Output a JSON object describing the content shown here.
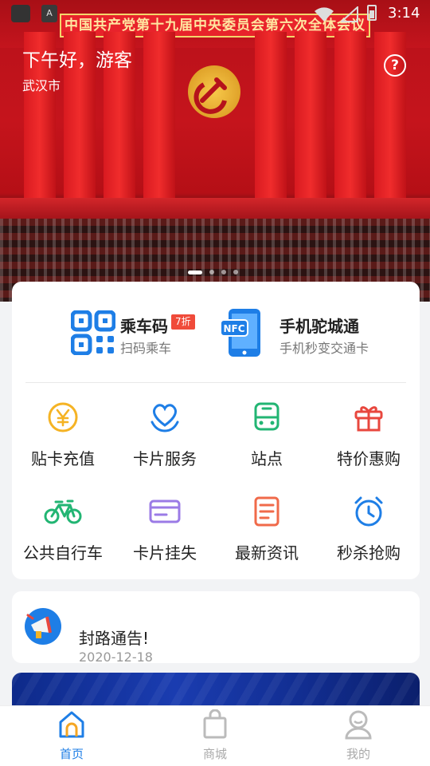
{
  "status_bar": {
    "time": "3:14"
  },
  "banner": {
    "headline": "中国共产党第十九届中央委员会第六次全体会议",
    "greeting": "下午好，游客",
    "city": "武汉市",
    "help_icon": "question-icon",
    "slide_count": 4,
    "active_slide": 1
  },
  "quick_pay": [
    {
      "title": "乘车码",
      "subtitle": "扫码乘车",
      "badge": "7折",
      "icon": "qr-code-icon"
    },
    {
      "title": "手机驼城通",
      "subtitle": "手机秒变交通卡",
      "icon": "nfc-phone-icon"
    }
  ],
  "services": [
    {
      "label": "贴卡充值",
      "icon": "yen-coin-icon",
      "color": "#f5b324"
    },
    {
      "label": "卡片服务",
      "icon": "heart-hands-icon",
      "color": "#1e7ee6"
    },
    {
      "label": "站点",
      "icon": "bus-icon",
      "color": "#22b573"
    },
    {
      "label": "特价惠购",
      "icon": "gift-icon",
      "color": "#e8473e"
    },
    {
      "label": "公共自行车",
      "icon": "bicycle-icon",
      "color": "#22b573"
    },
    {
      "label": "卡片挂失",
      "icon": "card-icon",
      "color": "#9b7be6"
    },
    {
      "label": "最新资讯",
      "icon": "document-icon",
      "color": "#f06a4a"
    },
    {
      "label": "秒杀抢购",
      "icon": "alarm-clock-icon",
      "color": "#1e7ee6"
    }
  ],
  "notice": {
    "title": "封路通告!",
    "date": "2020-12-18",
    "icon": "megaphone-icon"
  },
  "tabs": [
    {
      "label": "首页",
      "icon": "home-icon",
      "active": true
    },
    {
      "label": "商城",
      "icon": "shopping-bag-icon",
      "active": false
    },
    {
      "label": "我的",
      "icon": "user-icon",
      "active": false
    }
  ],
  "colors": {
    "primary": "#1e7ee6",
    "badge": "#f04b3a",
    "banner_red": "#c5141c"
  }
}
